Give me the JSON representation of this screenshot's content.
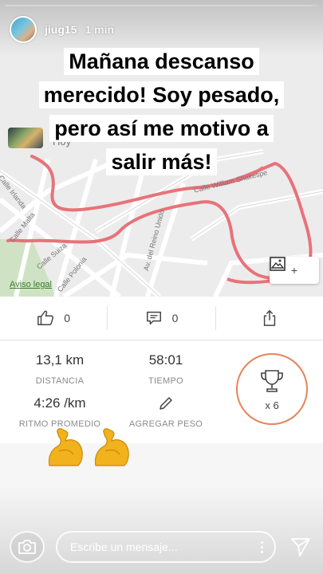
{
  "story": {
    "username": "jiug15",
    "time_ago": "1 min",
    "progress": 0.98,
    "caption_lines": [
      "Mañana descanso",
      "merecido! Soy pesado,",
      "pero así me motivo a",
      "salir más!"
    ]
  },
  "map": {
    "streets": [
      "Calle Irlanda",
      "Calle Malta",
      "Calle Suiza",
      "Calle Polonia",
      "Av. del Reino Unido",
      "Calle William Shakespe"
    ],
    "legal_link": "Aviso legal",
    "day_label": "Hoy",
    "route_color": "#e8727a",
    "add_photo_plus": "+"
  },
  "actions": {
    "likes": "0",
    "comments": "0"
  },
  "stats": {
    "distance_value": "13,1 km",
    "distance_label": "DISTANCIA",
    "time_value": "58:01",
    "time_label": "TIEMPO",
    "pace_value": "4:26 /km",
    "pace_label": "RITMO PROMEDIO",
    "add_weight_label": "AGREGAR PESO",
    "trophy_count": "x 6",
    "accent_color": "#e5845a"
  },
  "emoji": [
    "flexed-biceps",
    "flexed-biceps"
  ],
  "composer": {
    "placeholder": "Escribe un mensaje..."
  }
}
